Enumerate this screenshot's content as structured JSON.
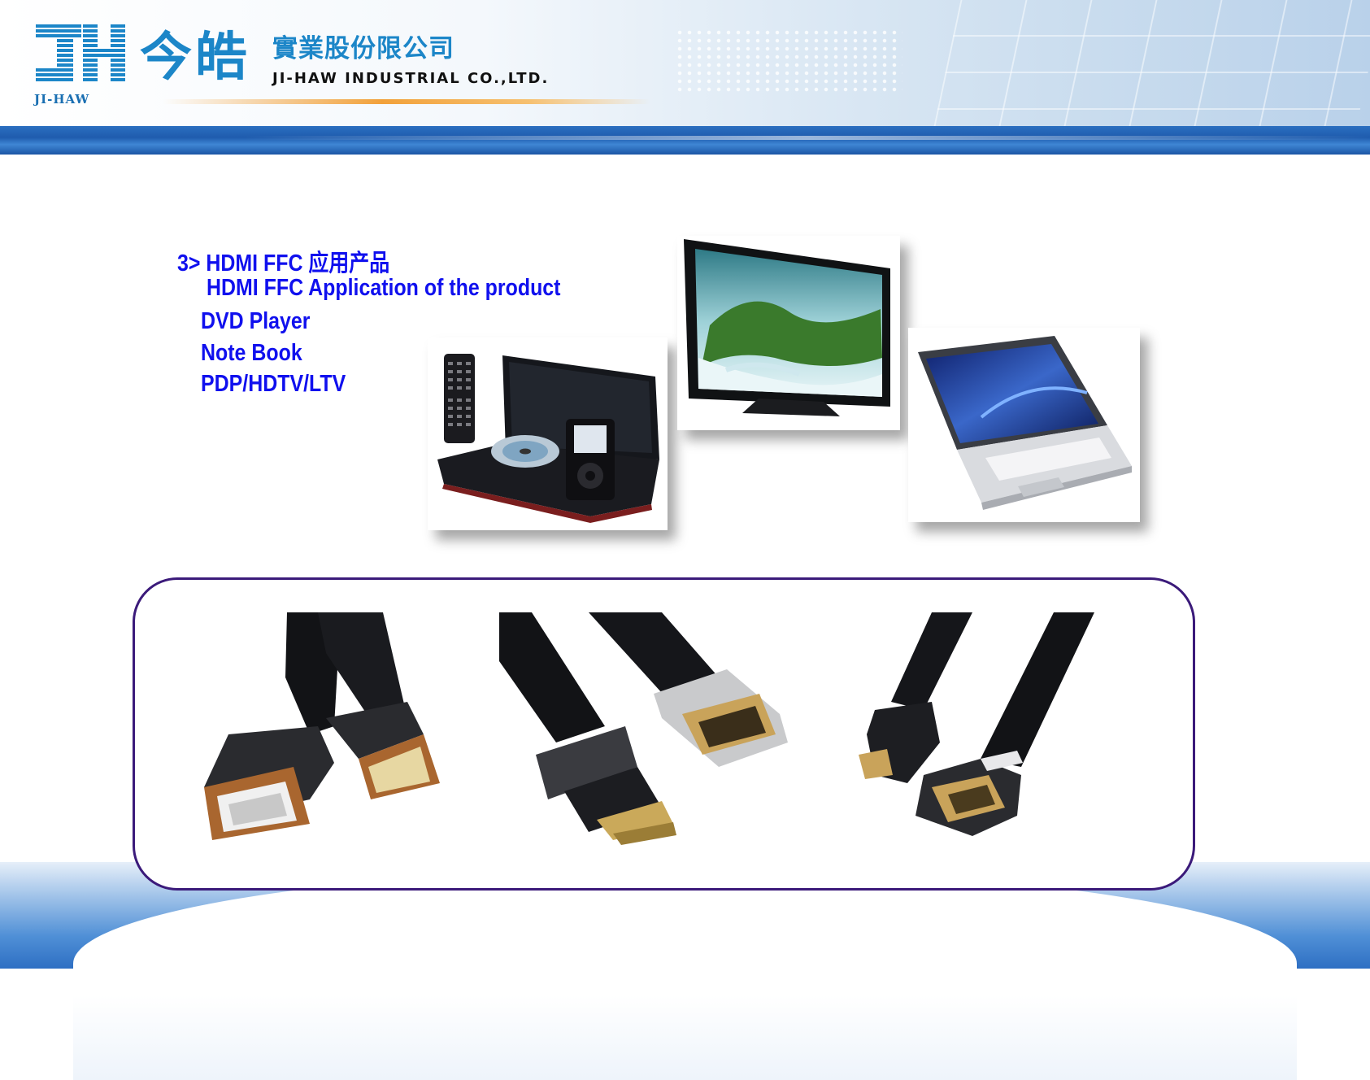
{
  "company": {
    "logo_letters": "JH",
    "logo_sub": "JI-HAW",
    "name_cn_big": "今皓",
    "name_cn_small": "實業股份限公司",
    "name_en": "JI-HAW INDUSTRIAL CO.,LTD."
  },
  "content": {
    "heading_cn": "3> HDMI FFC  应用产品",
    "heading_en": "HDMI FFC Application of the product",
    "items": [
      "DVD Player",
      "Note Book",
      "PDP/HDTV/LTV"
    ]
  },
  "colors": {
    "text_blue": "#1010ee",
    "brand_blue": "#1c86c8",
    "band_blue": "#1f5cae",
    "panel_border": "#3b1a7a"
  },
  "images": {
    "dvd": "portable-dvd-player-photo",
    "tv": "flat-panel-tv-photo",
    "notebook": "notebook-computer-photo",
    "cables": [
      "hdmi-ffc-cable-standard-photo",
      "hdmi-ffc-cable-mini-photo",
      "hdmi-ffc-cable-angled-photo"
    ]
  }
}
